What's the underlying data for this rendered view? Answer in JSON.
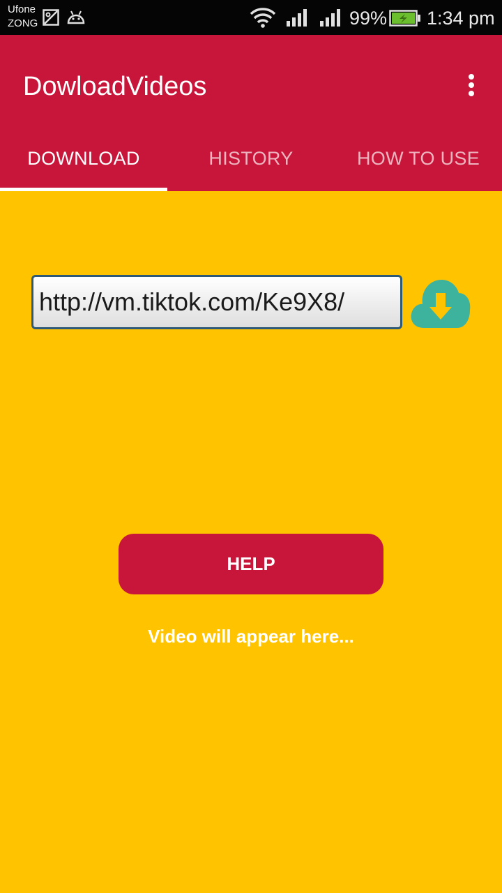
{
  "status_bar": {
    "carrier_1": "Ufone",
    "carrier_2": "ZONG",
    "battery": "99%",
    "time": "1:34 pm"
  },
  "app_bar": {
    "title": "DowloadVideos",
    "color": "#C8163A"
  },
  "tabs": [
    {
      "label": "DOWNLOAD",
      "selected": true
    },
    {
      "label": "HISTORY",
      "selected": false
    },
    {
      "label": "HOW TO USE",
      "selected": false
    }
  ],
  "main": {
    "background": "#FFC300",
    "url_input_value": "http://vm.tiktok.com/Ke9X8/",
    "download_icon": "cloud-download-icon",
    "help_label": "HELP",
    "video_placeholder": "Video will appear here..."
  },
  "icons": {
    "gallery": "gallery-icon",
    "android": "android-icon",
    "wifi": "wifi-icon",
    "signal": "signal-icon",
    "battery": "battery-charging-icon",
    "menu": "more-vert-icon"
  }
}
